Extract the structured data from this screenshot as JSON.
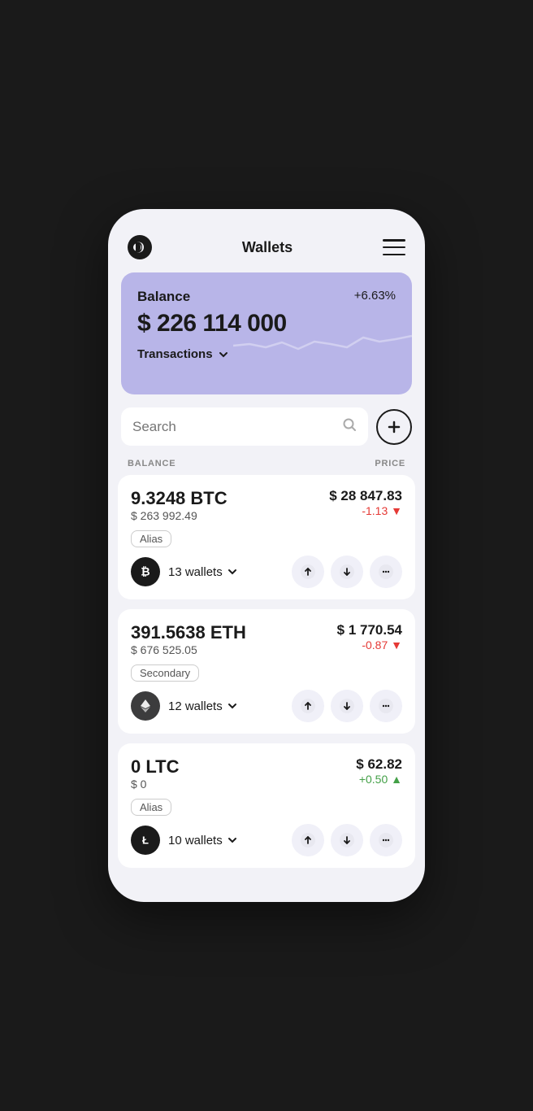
{
  "header": {
    "title": "Wallets",
    "menu_label": "menu"
  },
  "balance_card": {
    "label": "Balance",
    "change": "+6.63%",
    "amount": "$ 226 114 000",
    "transactions_label": "Transactions"
  },
  "search": {
    "placeholder": "Search",
    "add_button_label": "+"
  },
  "columns": {
    "balance_label": "BALANCE",
    "price_label": "PRICE"
  },
  "coins": [
    {
      "amount": "9.3248 BTC",
      "usd_value": "$ 263 992.49",
      "price": "$ 28 847.83",
      "change": "-1.13",
      "change_type": "negative",
      "alias": "Alias",
      "wallets": "13 wallets",
      "icon": "₿",
      "icon_style": "btc"
    },
    {
      "amount": "391.5638 ETH",
      "usd_value": "$ 676 525.05",
      "price": "$ 1 770.54",
      "change": "-0.87",
      "change_type": "negative",
      "alias": "Secondary",
      "wallets": "12 wallets",
      "icon": "◈",
      "icon_style": "eth"
    },
    {
      "amount": "0 LTC",
      "usd_value": "$ 0",
      "price": "$ 62.82",
      "change": "+0.50",
      "change_type": "positive",
      "alias": "Alias",
      "wallets": "10 wallets",
      "icon": "Ł",
      "icon_style": "ltc"
    }
  ],
  "colors": {
    "accent": "#b8b5e8",
    "negative": "#e53935",
    "positive": "#43a047",
    "card_bg": "#ffffff",
    "page_bg": "#f2f2f7"
  }
}
